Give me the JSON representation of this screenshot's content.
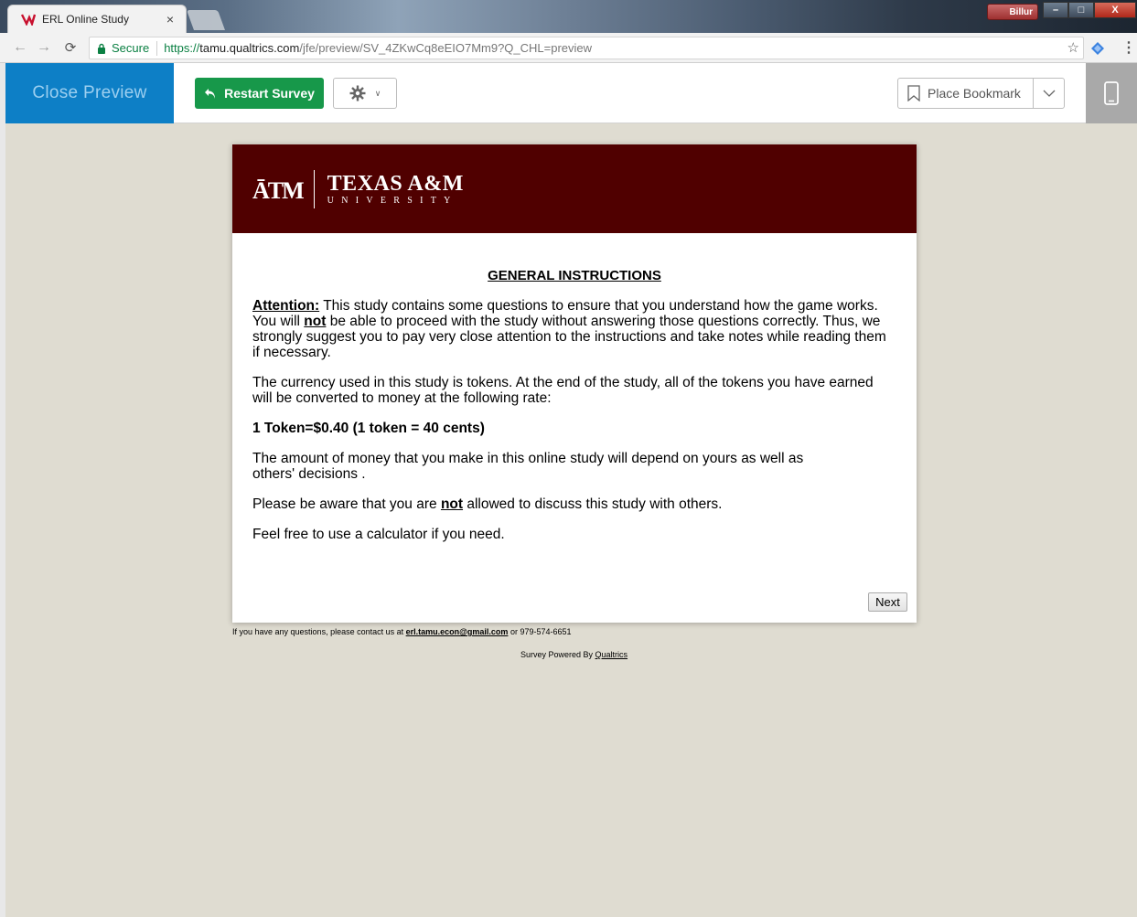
{
  "browser": {
    "tab_title": "ERL Online Study",
    "tab_close": "×",
    "user_badge": "Billur",
    "window_buttons": [
      "–",
      "□",
      "X"
    ],
    "secure_label": "Secure",
    "url_scheme": "https://",
    "url_host": "tamu.qualtrics.com",
    "url_path": "/jfe/preview/SV_4ZKwCq8eEIO7Mm9?Q_CHL=preview"
  },
  "preview_toolbar": {
    "close_preview_label": "Close Preview",
    "restart_label": "Restart Survey",
    "bookmark_label": "Place Bookmark",
    "accent_blue": "#0d7fc6",
    "accent_green": "#17984a"
  },
  "banner": {
    "mark": "ĀTM",
    "name": "TEXAS A&M",
    "sub": "UNIVERSITY",
    "color": "#500000"
  },
  "question": {
    "heading": "GENERAL INSTRUCTIONS",
    "p1_lead": "Attention:",
    "p1_a": " This study contains some questions to ensure that you understand how the game works. You will ",
    "p1_not": "not",
    "p1_b": " be able to proceed with the study without answering those questions correctly. Thus, we strongly suggest you to pay very close attention to the instructions and take notes while reading them if necessary.",
    "p2": "The currency used in this study is tokens.  At the end of the study, all of the tokens you have earned will be converted to money at the following rate:",
    "rate": "1 Token=$0.40 (1 token = 40 cents)",
    "p4a": "The amount of money that you make in this online study will depend on yours as well as",
    "p4b": "others' decisions .",
    "p5_a": "Please be aware that you are ",
    "p5_not": "not",
    "p5_b": " allowed to discuss this study with others.",
    "p6": "Feel free to use a calculator if you need.",
    "next_label": "Next"
  },
  "footer": {
    "contact_a": "If you have any questions, please contact us at ",
    "contact_email": "erl.tamu.econ@gmail.com",
    "contact_b": " or 979-574-6651",
    "powered_a": "Survey Powered By ",
    "powered_link": "Qualtrics"
  }
}
